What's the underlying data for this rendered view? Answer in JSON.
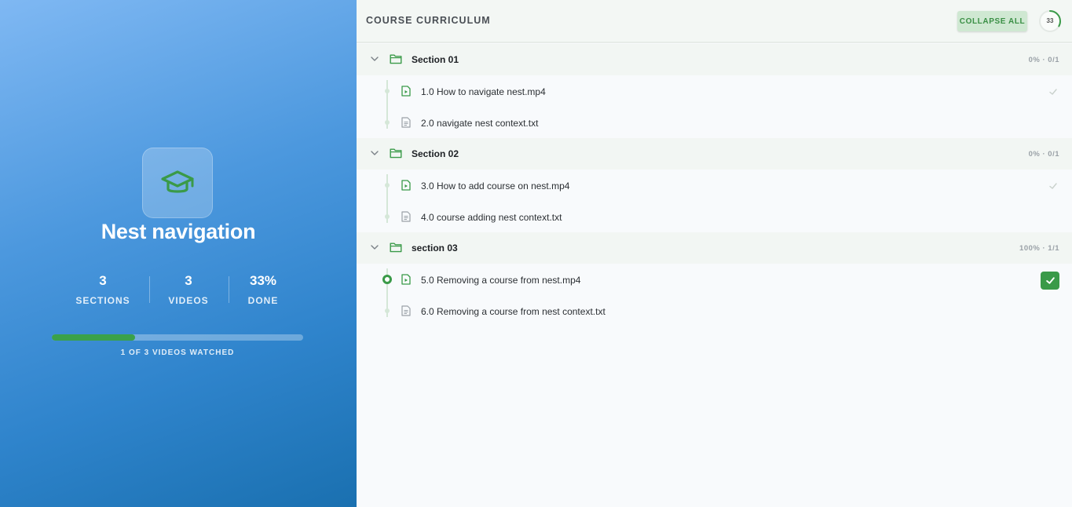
{
  "course": {
    "title": "Nest navigation",
    "icon": "graduation-cap-icon",
    "stats": [
      {
        "value": "3",
        "label": "SECTIONS"
      },
      {
        "value": "3",
        "label": "VIDEOS"
      },
      {
        "value": "33%",
        "label": "DONE"
      }
    ],
    "progress_fraction": 0.33,
    "progress_caption": "1 OF 3 VIDEOS WATCHED"
  },
  "header": {
    "title": "COURSE CURRICULUM",
    "collapse_label": "COLLAPSE ALL",
    "ring_value": "33",
    "ring_fraction": 0.33
  },
  "sections": [
    {
      "name": "Section 01",
      "meta": "0% · 0/1",
      "items": [
        {
          "name": "1.0 How to navigate nest.mp4",
          "type": "video",
          "status": "faint-check"
        },
        {
          "name": "2.0 navigate nest context.txt",
          "type": "text",
          "status": "none"
        }
      ]
    },
    {
      "name": "Section 02",
      "meta": "0% · 0/1",
      "items": [
        {
          "name": "3.0 How to add course on nest.mp4",
          "type": "video",
          "status": "faint-check"
        },
        {
          "name": "4.0 course adding nest context.txt",
          "type": "text",
          "status": "none"
        }
      ]
    },
    {
      "name": "section 03",
      "meta": "100% · 1/1",
      "items": [
        {
          "name": "5.0 Removing a course from nest.mp4",
          "type": "video",
          "status": "done",
          "active": true
        },
        {
          "name": "6.0 Removing a course from nest context.txt",
          "type": "text",
          "status": "none"
        }
      ]
    }
  ],
  "colors": {
    "accent_green": "#3a9a48",
    "panel_blue": "#2f84cc"
  }
}
